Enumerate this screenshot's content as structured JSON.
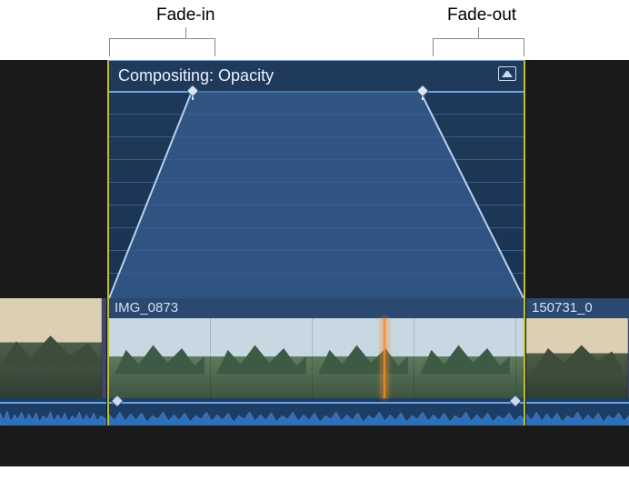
{
  "annotations": {
    "fade_in_label": "Fade-in",
    "fade_out_label": "Fade-out"
  },
  "compositing_panel": {
    "title": "Compositing: Opacity",
    "icon": "video-animation-icon",
    "fade_in_start_pct": 0,
    "fade_in_end_pct": 20,
    "fade_out_start_pct": 75,
    "fade_out_end_pct": 100
  },
  "clips": {
    "left": {
      "label": ""
    },
    "main": {
      "label": "IMG_0873"
    },
    "right": {
      "label": "150731_0"
    }
  }
}
